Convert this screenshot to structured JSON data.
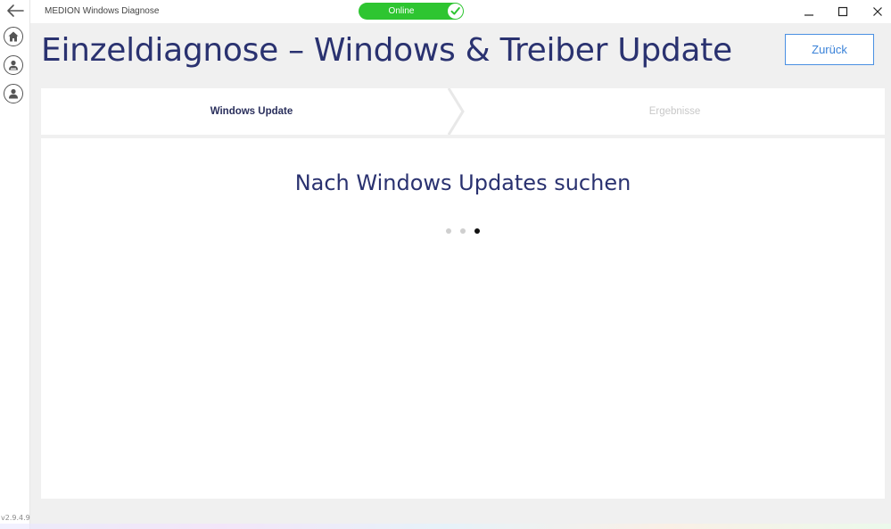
{
  "window": {
    "app_title": "MEDION Windows Diagnose",
    "status": {
      "label": "Online",
      "color": "#2ec531"
    },
    "controls": {
      "minimize_icon": "minimize-icon",
      "maximize_icon": "maximize-icon",
      "close_icon": "close-icon"
    }
  },
  "rail": {
    "back_icon": "back-arrow-icon",
    "items": [
      {
        "icon": "home-icon"
      },
      {
        "icon": "community-icon"
      },
      {
        "icon": "user-icon"
      }
    ],
    "version": "v2.9.4.9"
  },
  "header": {
    "title": "Einzeldiagnose  – Windows & Treiber Update",
    "back_button_label": "Zurück",
    "accent_color": "#4a90e2"
  },
  "steps": {
    "items": [
      {
        "label": "Windows Update",
        "state": "active"
      },
      {
        "label": "Ergebnisse",
        "state": "inactive"
      }
    ]
  },
  "main": {
    "heading": "Nach Windows Updates suchen",
    "progress_dots": {
      "count": 3,
      "active_index": 2
    }
  }
}
